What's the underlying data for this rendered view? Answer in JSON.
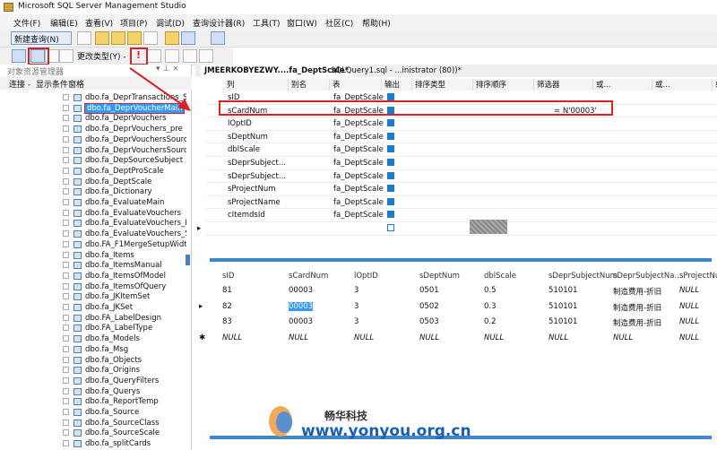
{
  "window": {
    "title": "Microsoft SQL Server Management Studio"
  },
  "menu": [
    "文件(F)",
    "编辑(E)",
    "查看(V)",
    "项目(P)",
    "调试(D)",
    "查询设计器(R)",
    "工具(T)",
    "窗口(W)",
    "社区(C)",
    "帮助(H)"
  ],
  "toolbar": {
    "new_query": "新建查询(N)",
    "change_type": "更改类型(Y) -"
  },
  "object_explorer": {
    "title": "对象资源管理器",
    "connect": "连接 -",
    "filter_label": "显示条件窗格",
    "tables": [
      "dbo.fa_DeprTransactions_So",
      "dbo.fa_DeprVoucherMain",
      "dbo.fa_DeprVouchers",
      "dbo.fa_DeprVouchers_pre",
      "dbo.fa_DeprVouchersSource",
      "dbo.fa_DeprVouchersSource",
      "dbo.fa_DepSourceSubject",
      "dbo.fa_DeptProScale",
      "dbo.fa_DeptScale",
      "dbo.fa_Dictionary",
      "dbo.fa_EvaluateMain",
      "dbo.fa_EvaluateVouchers",
      "dbo.fa_EvaluateVouchers_De",
      "dbo.fa_EvaluateVouchers_Sc",
      "dbo.FA_F1MergeSetupWidth",
      "dbo.fa_Items",
      "dbo.fa_ItemsManual",
      "dbo.fa_ItemsOfModel",
      "dbo.fa_ItemsOfQuery",
      "dbo.fa_JKItemSet",
      "dbo.fa_JKSet",
      "dbo.FA_LabelDesign",
      "dbo.FA_LabelType",
      "dbo.fa_Models",
      "dbo.fa_Msg",
      "dbo.fa_Objects",
      "dbo.fa_Origins",
      "dbo.fa_QueryFilters",
      "dbo.fa_Querys",
      "dbo.fa_ReportTemp",
      "dbo.fa_Source",
      "dbo.fa_SourceClass",
      "dbo.fa_SourceScale",
      "dbo.fa_splitCards"
    ],
    "selected_index": 1
  },
  "tabs": [
    {
      "label": "JMEERKOBYEZWY....fa_DeptScale*",
      "active": true
    },
    {
      "label": "SQLQuery1.sql - ...inistrator (80))*",
      "active": false
    }
  ],
  "criteria": {
    "headers": [
      "列",
      "别名",
      "表",
      "输出",
      "排序类型",
      "排序顺序",
      "筛选器",
      "或...",
      "或...",
      "或..."
    ],
    "rows": [
      {
        "col": "sID",
        "table": "fa_DeptScale",
        "out": true,
        "filter": ""
      },
      {
        "col": "sCardNum",
        "table": "fa_DeptScale",
        "out": true,
        "filter": "= N'00003'"
      },
      {
        "col": "lOptID",
        "table": "fa_DeptScale",
        "out": true,
        "filter": ""
      },
      {
        "col": "sDeptNum",
        "table": "fa_DeptScale",
        "out": true,
        "filter": ""
      },
      {
        "col": "dblScale",
        "table": "fa_DeptScale",
        "out": true,
        "filter": ""
      },
      {
        "col": "sDeprSubject...",
        "table": "fa_DeptScale",
        "out": true,
        "filter": ""
      },
      {
        "col": "sDeprSubject...",
        "table": "fa_DeptScale",
        "out": true,
        "filter": ""
      },
      {
        "col": "sProjectNum",
        "table": "fa_DeptScale",
        "out": true,
        "filter": ""
      },
      {
        "col": "sProjectName",
        "table": "fa_DeptScale",
        "out": true,
        "filter": ""
      },
      {
        "col": "cItemdsId",
        "table": "fa_DeptScale",
        "out": true,
        "filter": ""
      }
    ]
  },
  "results": {
    "headers": [
      "sID",
      "sCardNum",
      "lOptID",
      "sDeptNum",
      "dblScale",
      "sDeprSubjectNum",
      "sDeprSubjectNa...",
      "sProjectNu"
    ],
    "rows": [
      [
        "81",
        "00003",
        "3",
        "0501",
        "0.5",
        "510101",
        "制造费用-折旧",
        "NULL"
      ],
      [
        "82",
        "00003",
        "3",
        "0502",
        "0.3",
        "510101",
        "制造费用-折旧",
        "NULL"
      ],
      [
        "83",
        "00003",
        "3",
        "0503",
        "0.2",
        "510101",
        "制造费用-折旧",
        "NULL"
      ],
      [
        "NULL",
        "NULL",
        "NULL",
        "NULL",
        "NULL",
        "NULL",
        "NULL",
        "NULL"
      ]
    ]
  },
  "watermark": {
    "cn": "畅华科技",
    "url": "www.yonyou.org.cn"
  }
}
